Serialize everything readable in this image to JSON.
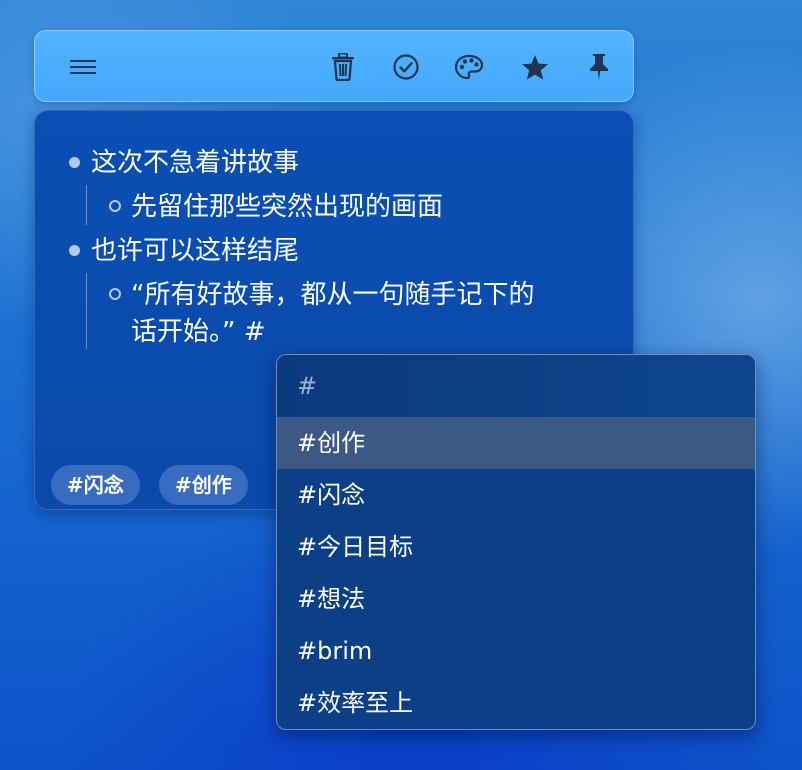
{
  "toolbar": {
    "icons": [
      "menu-icon",
      "trash-icon",
      "check-circle-icon",
      "palette-icon",
      "star-icon",
      "pin-icon"
    ]
  },
  "note": {
    "lines": [
      {
        "text": "这次不急着讲故事",
        "level": 1
      },
      {
        "text": "先留住那些突然出现的画面",
        "level": 2
      },
      {
        "text": "也许可以这样结尾",
        "level": 1
      },
      {
        "text": "“所有好故事，都从一句随手记下的",
        "level": 2
      },
      {
        "text": "话开始。” #",
        "level": 2
      }
    ],
    "tags": [
      "#闪念",
      "#创作"
    ]
  },
  "tag_dropdown": {
    "query": "#",
    "selected_index": 0,
    "options": [
      "#创作",
      "#闪念",
      "#今日目标",
      "#想法",
      "#brim",
      "#效率至上"
    ]
  },
  "colors": {
    "toolbar_bg": "#4aaefd",
    "note_bg": "#0b4db0",
    "dropdown_bg": "#0b3f86",
    "selected_bg": "#3a5a85",
    "icon_color": "#1f3550"
  }
}
